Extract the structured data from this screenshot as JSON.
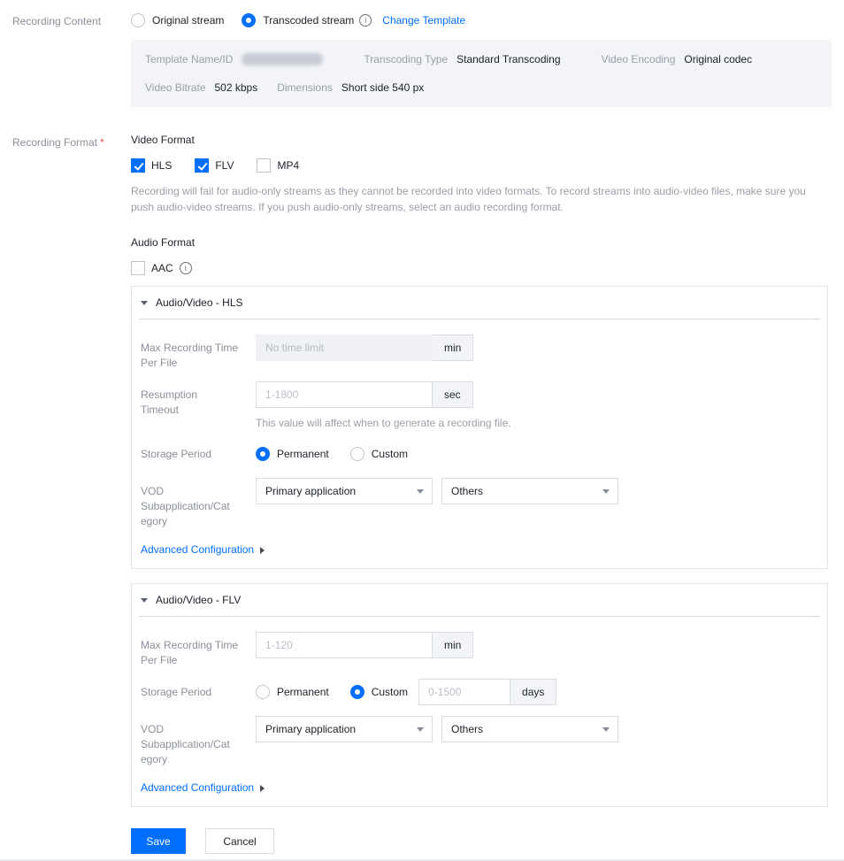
{
  "colors": {
    "accent": "#006eff",
    "link": "#006eff",
    "required": "#e34d59",
    "panel_border": "#e3e5ea",
    "info_box_bg": "#f3f4f7"
  },
  "icons": {
    "info": "i"
  },
  "recording_content": {
    "label": "Recording Content",
    "original_stream": "Original stream",
    "original_selected": false,
    "transcoded_stream": "Transcoded stream",
    "transcoded_selected": true,
    "change_template": "Change Template"
  },
  "template_box": {
    "row1": [
      {
        "label": "Template Name/ID",
        "value": "",
        "redacted": true
      },
      {
        "label": "Transcoding Type",
        "value": "Standard Transcoding"
      },
      {
        "label": "Video Encoding",
        "value": "Original codec"
      }
    ],
    "row2": [
      {
        "label": "Video Bitrate",
        "value": "502 kbps"
      },
      {
        "label": "Dimensions",
        "value": "Short side 540 px"
      }
    ]
  },
  "recording_format": {
    "label": "Recording Format",
    "required": "*",
    "video_format_title": "Video Format",
    "video_formats": [
      {
        "label": "HLS",
        "checked": true
      },
      {
        "label": "FLV",
        "checked": true
      },
      {
        "label": "MP4",
        "checked": false
      }
    ],
    "video_help": "Recording will fail for audio-only streams as they cannot be recorded into video formats. To record streams into audio-video files, make sure you push audio-video streams. If you push audio-only streams, select an audio recording format.",
    "audio_format_title": "Audio Format",
    "audio_format": {
      "label": "AAC",
      "checked": false
    }
  },
  "hls_panel": {
    "title": "Audio/Video - HLS",
    "max_recording_label": "Max Recording Time Per File",
    "max_recording_placeholder": "No time limit",
    "max_recording_disabled": true,
    "max_recording_unit": "min",
    "resumption_label": "Resumption Timeout",
    "resumption_placeholder": "1-1800",
    "resumption_unit": "sec",
    "resumption_help": "This value will affect when to generate a recording file.",
    "storage_label": "Storage Period",
    "storage_permanent": "Permanent",
    "storage_custom": "Custom",
    "storage_selected": "Permanent",
    "vod_label": "VOD Subapplication/Category",
    "vod_select_1": "Primary application",
    "vod_select_2": "Others",
    "advanced": "Advanced Configuration"
  },
  "flv_panel": {
    "title": "Audio/Video - FLV",
    "max_recording_label": "Max Recording Time Per File",
    "max_recording_placeholder": "1-120",
    "max_recording_unit": "min",
    "storage_label": "Storage Period",
    "storage_permanent": "Permanent",
    "storage_custom": "Custom",
    "storage_selected": "Custom",
    "storage_custom_placeholder": "0-1500",
    "storage_custom_unit": "days",
    "vod_label": "VOD Subapplication/Category",
    "vod_select_1": "Primary application",
    "vod_select_2": "Others",
    "advanced": "Advanced Configuration"
  },
  "actions": {
    "save": "Save",
    "cancel": "Cancel"
  }
}
